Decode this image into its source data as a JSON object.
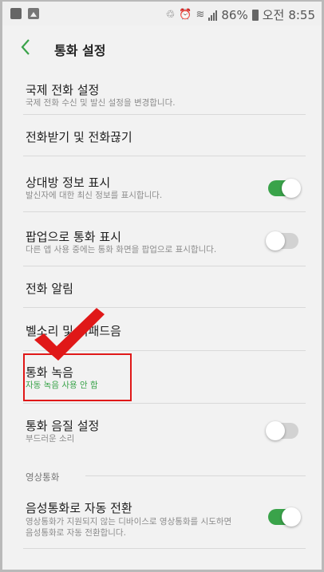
{
  "status_bar": {
    "icons_left": [
      "uplus-icon",
      "gallery-icon"
    ],
    "battery": "86%",
    "ampm": "오전",
    "time": "8:55"
  },
  "header": {
    "back_icon": "chevron-left-icon",
    "title": "통화 설정"
  },
  "rows": [
    {
      "id": "international",
      "title": "국제 전화 설정",
      "subtitle": "국제 전화 수신 및 발신 설정을 변경합니다."
    },
    {
      "id": "answer-end",
      "title": "전화받기 및 전화끊기",
      "subtitle": ""
    },
    {
      "id": "caller-info",
      "title": "상대방 정보 표시",
      "subtitle": "발신자에 대한 최신 정보를 표시합니다.",
      "toggle": "on"
    },
    {
      "id": "popup-call",
      "title": "팝업으로 통화 표시",
      "subtitle": "다른 앱 사용 중에는 통화 화면을 팝업으로 표시합니다.",
      "toggle": "off"
    },
    {
      "id": "call-alerts",
      "title": "전화 알림",
      "subtitle": ""
    },
    {
      "id": "ringtone",
      "title": "벨소리 및 키패드음",
      "subtitle": ""
    },
    {
      "id": "call-recording",
      "title": "통화 녹음",
      "subtitle": "자동 녹음 사용 안 함"
    },
    {
      "id": "call-quality",
      "title": "통화 음질 설정",
      "subtitle": "부드러운 소리",
      "toggle": "off"
    }
  ],
  "video_section": {
    "header": "영상통화",
    "row": {
      "title": "음성통화로 자동 전환",
      "subtitle_line1": "영상통화가 지원되지 않는 디바이스로 영상통화를 시도하면",
      "subtitle_line2": "음성통화로 자동 전환합니다.",
      "toggle": "on"
    }
  },
  "colors": {
    "accent": "#3aa34a",
    "highlight": "#e01818"
  }
}
